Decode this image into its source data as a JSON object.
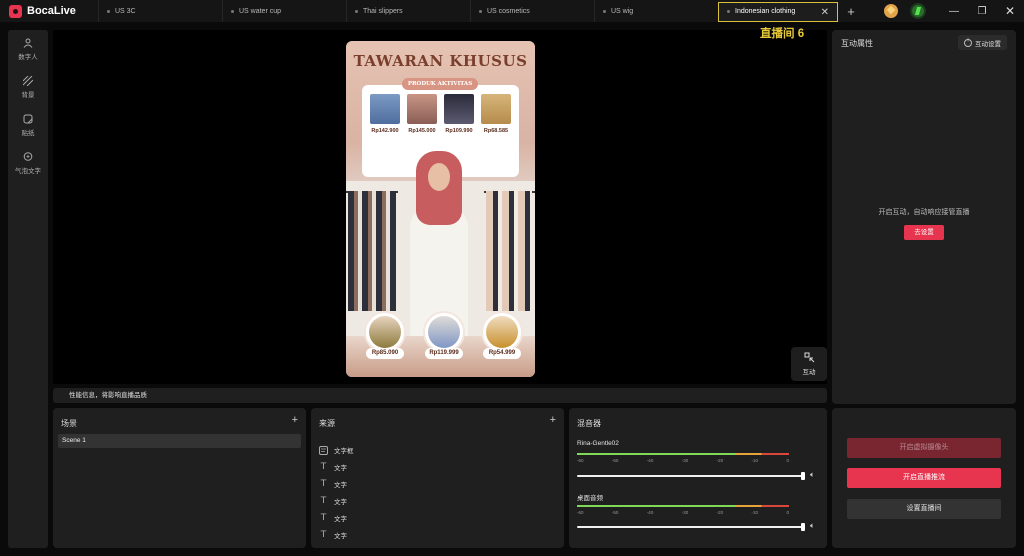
{
  "app": {
    "name": "BocaLive",
    "tabs": [
      {
        "label": "US 3C",
        "active": false
      },
      {
        "label": "US water cup",
        "active": false
      },
      {
        "label": "Thai slippers",
        "active": false
      },
      {
        "label": "US cosmetics",
        "active": false
      },
      {
        "label": "US wig",
        "active": false
      },
      {
        "label": "Indonesian clothing",
        "active": true
      }
    ],
    "add_tab": "+"
  },
  "sidebar": {
    "items": [
      {
        "label": "数字人",
        "icon": "person-icon"
      },
      {
        "label": "背景",
        "icon": "background-icon"
      },
      {
        "label": "贴纸",
        "icon": "sticker-icon"
      },
      {
        "label": "气泡文字",
        "icon": "bubble-text-icon"
      }
    ]
  },
  "stage": {
    "room_title": "直播间 6",
    "preview": {
      "headline": "TAWARAN KHUSUS",
      "banner": "PRODUK AKTIVITAS",
      "top_prices": [
        "Rp142.900",
        "Rp145.000",
        "Rp109.990",
        "Rp68.585"
      ],
      "bottom_prices": [
        "Rp85.090",
        "Rp119.999",
        "Rp54.999"
      ]
    },
    "interact_button": "互动"
  },
  "perf_bar": {
    "text": "性能信息，将影响直播品质"
  },
  "interaction_panel": {
    "title": "互动属性",
    "settings_button": "互动设置",
    "hint": "开启互动，自动响应接管直播",
    "go_button": "去设置"
  },
  "scene_panel": {
    "title": "场景",
    "add": "+",
    "items": [
      "Scene 1"
    ]
  },
  "source_panel": {
    "title": "来源",
    "add": "+",
    "items": [
      {
        "label": "文字框",
        "icon": "textbox-icon"
      },
      {
        "label": "文字",
        "icon": "text-icon"
      },
      {
        "label": "文字",
        "icon": "text-icon"
      },
      {
        "label": "文字",
        "icon": "text-icon"
      },
      {
        "label": "文字",
        "icon": "text-icon"
      },
      {
        "label": "文字",
        "icon": "text-icon"
      }
    ]
  },
  "mixer": {
    "title": "混音器",
    "ticks": [
      "-60",
      "-50",
      "-40",
      "-30",
      "-20",
      "-10",
      "0"
    ],
    "tracks": [
      {
        "name": "Rina-Gentle02",
        "volume": 1.0
      },
      {
        "name": "桌面音频",
        "volume": 1.0
      }
    ]
  },
  "actions": {
    "virtual_camera": "开启虚拟摄像头",
    "start_stream": "开启直播推流",
    "room_settings": "设置直播间",
    "colors": {
      "primary": "#e8354f",
      "disabled": "#7a2630",
      "secondary": "#333333"
    }
  }
}
